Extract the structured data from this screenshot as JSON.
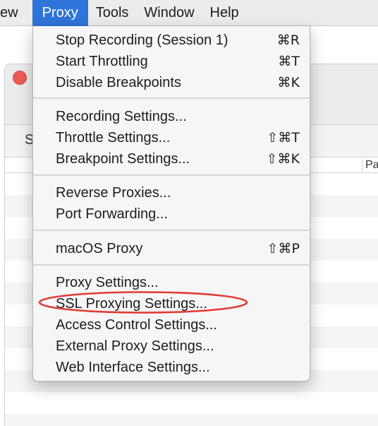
{
  "menubar": {
    "items": [
      {
        "label": "ew"
      },
      {
        "label": "Proxy"
      },
      {
        "label": "Tools"
      },
      {
        "label": "Window"
      },
      {
        "label": "Help"
      }
    ]
  },
  "background_window": {
    "tab_fragment": "S",
    "column_fragment": "Pa"
  },
  "proxy_menu": {
    "groups": [
      {
        "items": [
          {
            "label": "Stop Recording (Session 1)",
            "shortcut": "⌘R"
          },
          {
            "label": "Start Throttling",
            "shortcut": "⌘T"
          },
          {
            "label": "Disable Breakpoints",
            "shortcut": "⌘K"
          }
        ]
      },
      {
        "items": [
          {
            "label": "Recording Settings..."
          },
          {
            "label": "Throttle Settings...",
            "shortcut": "⇧⌘T"
          },
          {
            "label": "Breakpoint Settings...",
            "shortcut": "⇧⌘K"
          }
        ]
      },
      {
        "items": [
          {
            "label": "Reverse Proxies..."
          },
          {
            "label": "Port Forwarding..."
          }
        ]
      },
      {
        "items": [
          {
            "label": "macOS Proxy",
            "shortcut": "⇧⌘P"
          }
        ]
      },
      {
        "items": [
          {
            "label": "Proxy Settings..."
          },
          {
            "label": "SSL Proxying Settings..."
          },
          {
            "label": "Access Control Settings..."
          },
          {
            "label": "External Proxy Settings..."
          },
          {
            "label": "Web Interface Settings..."
          }
        ]
      }
    ]
  },
  "colors": {
    "menu_highlight": "#2f74d8",
    "annotation_circle": "#e03b32",
    "close_button": "#ee5b55"
  }
}
